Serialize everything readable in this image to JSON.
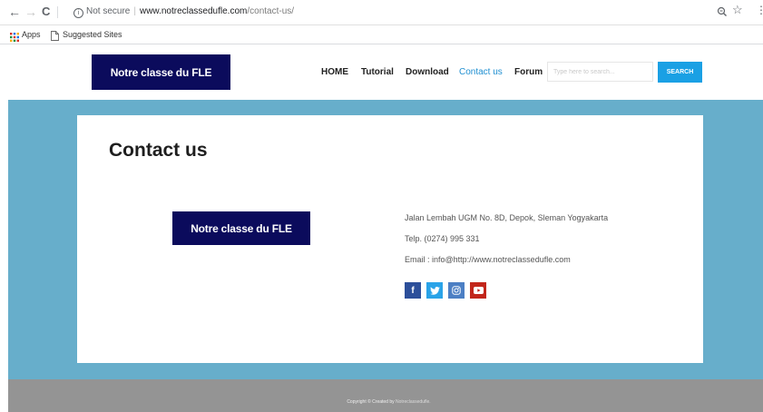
{
  "browser": {
    "back": "←",
    "forward": "→",
    "reload": "C",
    "security_label": "Not secure",
    "url_domain": "www.notreclassedufle.com",
    "url_path": "/contact-us/",
    "zoom_icon": "zoom-icon",
    "star_icon": "star-icon",
    "menu_icon": "menu-icon"
  },
  "bookmarks": {
    "apps_label": "Apps",
    "suggested_label": "Suggested Sites"
  },
  "header": {
    "logo_text": "Notre classe du FLE",
    "nav": [
      "HOME",
      "Tutorial",
      "Download",
      "Contact us",
      "Forum"
    ],
    "active_nav": "Contact us",
    "search_placeholder": "Type here to search...",
    "search_button": "SEARCH"
  },
  "main": {
    "title": "Contact us",
    "logo_text": "Notre classe du FLE",
    "address": "Jalan Lembah UGM No. 8D, Depok, Sleman Yogyakarta",
    "phone": "Telp. (0274) 995 331",
    "email": "Email : info@http://www.notreclassedufle.com",
    "social": [
      "facebook-icon",
      "twitter-icon",
      "instagram-icon",
      "youtube-icon"
    ]
  },
  "footer": {
    "copyright": "Copyright © Created by",
    "brand": "Notreclassedufle."
  },
  "colors": {
    "logo_bg": "#0b0b5c",
    "band": "#67aecb",
    "nav_active": "#1f8fd1",
    "search_button": "#1aa0e4",
    "footer": "#949494"
  }
}
